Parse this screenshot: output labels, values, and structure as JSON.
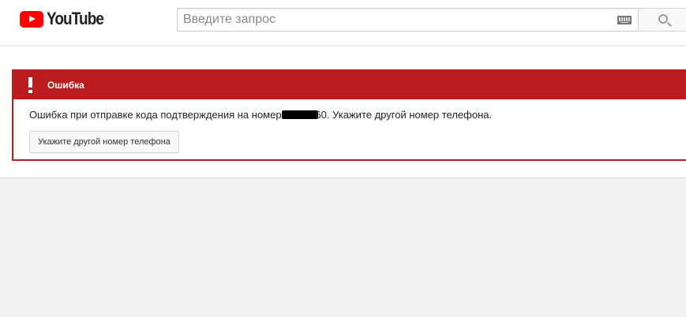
{
  "header": {
    "logo_text": "YouTube",
    "search_placeholder": "Введите запрос"
  },
  "error": {
    "title": "Ошибка",
    "message_prefix": "Ошибка при отправке кода подтверждения на номер 0",
    "message_suffix": "60. Укажите другой номер телефона.",
    "button_label": "Укажите другой номер телефона"
  },
  "colors": {
    "error_red": "#b91d1d",
    "logo_red": "#ff0000",
    "page_bg": "#f1f1f1"
  },
  "icons": {
    "logo": "youtube-play-icon",
    "keyboard": "keyboard-icon",
    "search": "search-icon",
    "alert": "exclamation-icon"
  }
}
